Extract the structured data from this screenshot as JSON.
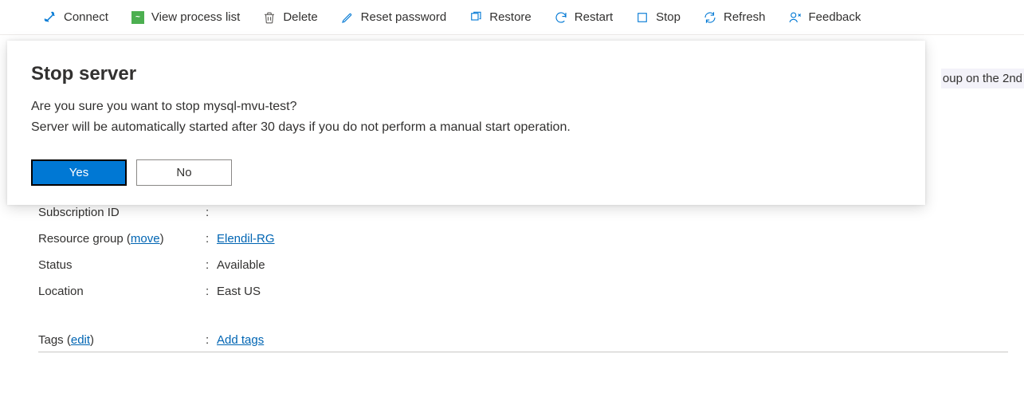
{
  "toolbar": {
    "connect": "Connect",
    "view_process": "View process list",
    "delete": "Delete",
    "reset_password": "Reset password",
    "restore": "Restore",
    "restart": "Restart",
    "stop": "Stop",
    "refresh": "Refresh",
    "feedback": "Feedback"
  },
  "dialog": {
    "title": "Stop server",
    "body": "Are you sure you want to stop mysql-mvu-test?\nServer will be automatically started after 30 days if you do not perform a manual start operation.",
    "yes": "Yes",
    "no": "No"
  },
  "details": {
    "subscription_id_label": "Subscription ID",
    "subscription_id_value": "",
    "resource_group_label": "Resource group",
    "resource_group_move": "move",
    "resource_group_value": "Elendil-RG",
    "status_label": "Status",
    "status_value": "Available",
    "location_label": "Location",
    "location_value": "East US",
    "tags_label": "Tags",
    "tags_edit": "edit",
    "tags_value": "Add tags"
  },
  "banner_partial": "oup on the 2nd"
}
